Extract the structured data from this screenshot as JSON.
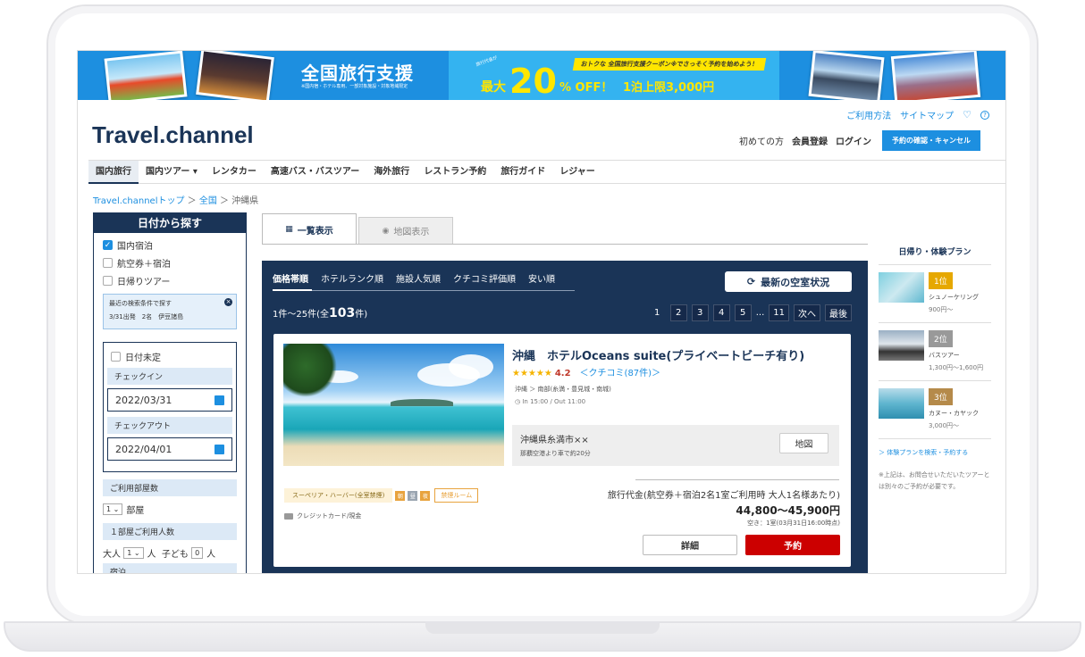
{
  "banner": {
    "title": "全国旅行支援",
    "subtitle": "※国内宿・ホテル専用、一部対象施設・対象地域限定",
    "tiny": "旅行代金が",
    "ribbon": "おトクな 全国旅行支援クーポン※でさっそく予約を始めよう！",
    "max": "最大",
    "percent": "20",
    "off": "% OFF！",
    "cap": "1泊上限3,000円"
  },
  "header": {
    "logo": "Travel.channel",
    "links": [
      "ご利用方法",
      "サイトマップ"
    ],
    "first": "初めての方",
    "register": "会員登録",
    "login": "ログイン",
    "reservation": "予約の確認・キャンセル"
  },
  "nav": [
    "国内旅行",
    "国内ツアー ▾",
    "レンタカー",
    "高速バス・バスツアー",
    "海外旅行",
    "レストラン予約",
    "旅行ガイド",
    "レジャー"
  ],
  "breadcrumb": [
    "Travel.channelトップ",
    "全国",
    "沖縄県"
  ],
  "sidebar": {
    "title": "日付から探す",
    "checks": [
      {
        "label": "国内宿泊",
        "checked": true
      },
      {
        "label": "航空券＋宿泊",
        "checked": false
      },
      {
        "label": "日帰りツアー",
        "checked": false
      }
    ],
    "recent_title": "最近の検索条件で探す",
    "recent_value": "3/31出発　2名　伊豆諸島",
    "undecided": "日付未定",
    "checkin_label": "チェックイン",
    "checkin": "2022/03/31",
    "checkout_label": "チェックアウト",
    "checkout": "2022/04/01",
    "rooms_label": "ご利用部屋数",
    "rooms_value": "1",
    "rooms_unit": "部屋",
    "people_label": "１部屋ご利用人数",
    "adult": "大人",
    "adult_value": "1",
    "person": "人",
    "child": "子ども",
    "child_value": "0",
    "more": "宿泊"
  },
  "tabs": {
    "list": "一覧表示",
    "map": "地図表示"
  },
  "results": {
    "sorts": [
      "価格帯順",
      "ホテルランク順",
      "施設人気順",
      "クチコミ評価順",
      "安い順"
    ],
    "availability": "最新の空室状況",
    "count_prefix": "1件～25件(全",
    "count": "103",
    "count_suffix": "件)",
    "pages": [
      "1",
      "2",
      "3",
      "4",
      "5",
      "...",
      "11",
      "次へ",
      "最後"
    ]
  },
  "hotel": {
    "title": "沖縄　ホテルOceans suite(プライベートビーチ有り)",
    "stars": "★★★★★",
    "rating": "4.2",
    "reviews": "＜クチコミ(87件)＞",
    "location": "沖縄 ＞ 南部(糸満・豊見城・南城)",
    "time": "In 15:00 / Out 11:00",
    "address": "沖縄県糸満市××",
    "access": "那覇空港より車で約20分",
    "map": "地図",
    "room_type": "スーペリア・ハーバー(全室禁煙)",
    "meals": [
      "朝",
      "昼",
      "夜"
    ],
    "smoking": "禁煙ルーム",
    "payment": "クレジットカード/現金",
    "price_label": "旅行代金(航空券＋宿泊2名1室ご利用時 大人1名様あたり)",
    "price": "44,800～45,900円",
    "vacancy": "空き：1室(03月31日16:00時点)",
    "detail": "詳細",
    "reserve": "予約"
  },
  "right": {
    "title": "日帰り・体験プラン",
    "ranks": [
      {
        "rank": "1位",
        "name": "シュノーケリング",
        "price": "900円～",
        "color": "#e6a800"
      },
      {
        "rank": "2位",
        "name": "バスツアー",
        "price": "1,300円～1,600円",
        "color": "#999999"
      },
      {
        "rank": "3位",
        "name": "カヌー・カヤック",
        "price": "3,000円～",
        "color": "#b58a4a"
      }
    ],
    "link": "＞ 体験プランを検索・予約する",
    "note": "※上記は、お問合せいただいたツアーとは別々のご予約が必要です。"
  }
}
